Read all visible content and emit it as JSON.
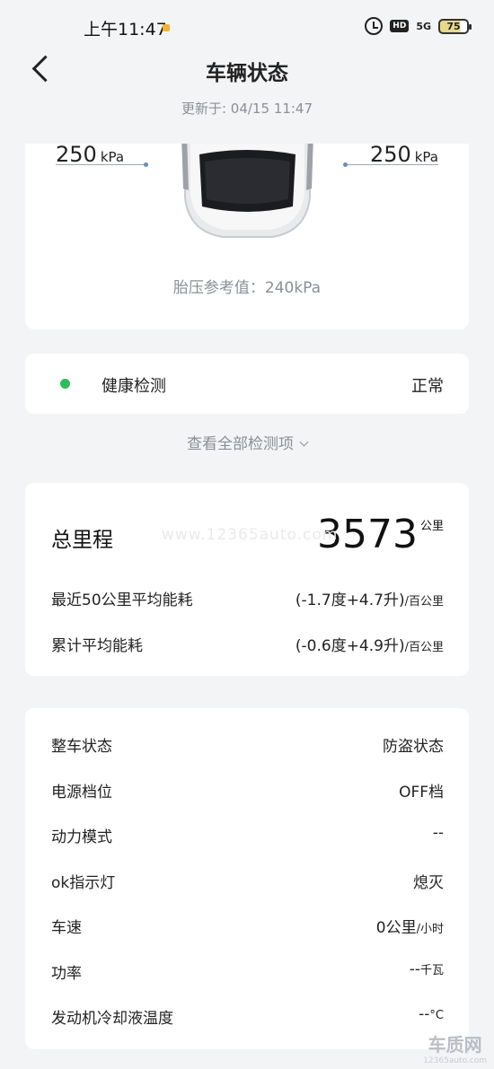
{
  "status_bar": {
    "time": "上午11:47",
    "hd": "HD",
    "network": "5G",
    "battery": "75"
  },
  "header": {
    "title": "车辆状态",
    "updated": "更新于: 04/15 11:47"
  },
  "tire": {
    "left_value": "250",
    "left_unit": "kPa",
    "right_value": "250",
    "right_unit": "kPa",
    "reference": "胎压参考值：240kPa"
  },
  "health": {
    "label": "健康检测",
    "value": "正常",
    "status_color": "#2cbc5c"
  },
  "view_all": "查看全部检测项",
  "mileage": {
    "label": "总里程",
    "value": "3573",
    "unit": "公里",
    "rows": [
      {
        "label": "最近50公里平均能耗",
        "value": "(-1.7度+4.7升)",
        "unit": "/百公里"
      },
      {
        "label": "累计平均能耗",
        "value": "(-0.6度+4.9升)",
        "unit": "/百公里"
      }
    ]
  },
  "vehicle_status": [
    {
      "label": "整车状态",
      "value": "防盗状态",
      "unit": ""
    },
    {
      "label": "电源档位",
      "value": "OFF档",
      "unit": ""
    },
    {
      "label": "动力模式",
      "value": "--",
      "unit": ""
    },
    {
      "label": "ok指示灯",
      "value": "熄灭",
      "unit": ""
    },
    {
      "label": "车速",
      "value": "0公里",
      "unit": "/小时"
    },
    {
      "label": "功率",
      "value": "--",
      "unit": "千瓦"
    },
    {
      "label": "发动机冷却液温度",
      "value": "--",
      "unit": "°C"
    }
  ],
  "watermark": {
    "center": "www.12365auto.com",
    "corner_big": "车质网",
    "corner_small": "12365auto.com"
  },
  "colors": {
    "background": "#f3f4f6",
    "card": "#ffffff",
    "muted_text": "#8b8f96"
  }
}
